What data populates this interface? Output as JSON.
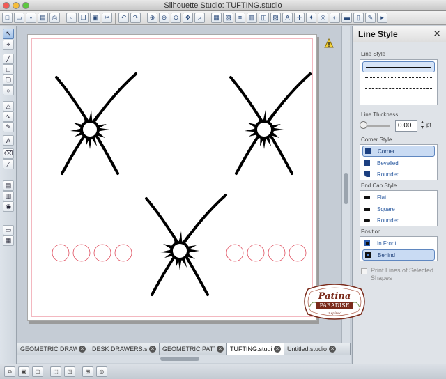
{
  "window": {
    "title": "Silhouette Studio: TUFTING.studio"
  },
  "toolbar": {
    "buttons": [
      "new-icon",
      "open-icon",
      "save-icon",
      "save-as-icon",
      "print-icon",
      "cut-to-icon",
      "copy-icon",
      "paste-icon",
      "scissors-icon",
      "undo-icon",
      "redo-icon",
      "zoom-in-icon",
      "zoom-out-icon",
      "zoom-select-icon",
      "pan-icon",
      "zoom-fit-icon",
      "view-icon",
      "grid-icon",
      "align-icon",
      "replicate-icon",
      "offset-icon",
      "trace-icon",
      "text-icon",
      "transform-icon",
      "point-icon",
      "select-icon",
      "fill-icon",
      "line-icon",
      "cut-icon",
      "star-icon",
      "send-icon"
    ]
  },
  "left_tools": [
    "select-tool-icon",
    "point-edit-icon",
    "line-tool-icon",
    "rectangle-tool-icon",
    "rounded-rect-icon",
    "ellipse-tool-icon",
    "polygon-tool-icon",
    "curve-tool-icon",
    "arc-tool-icon",
    "freehand-tool-icon",
    "text-tool-icon",
    "eraser-tool-icon",
    "knife-tool-icon",
    "library-icon",
    "store-icon",
    "online-icon",
    "design-page-icon",
    "layers-icon"
  ],
  "canvas": {
    "warning_icon": "warning-triangle-icon",
    "colors": {
      "stroke": "#000000",
      "registration": "#e05060"
    }
  },
  "tabs": [
    {
      "label": "GEOMETRIC DRAW...",
      "active": false
    },
    {
      "label": "DESK DRAWERS.st...",
      "active": false
    },
    {
      "label": "GEOMETRIC PATT...",
      "active": false
    },
    {
      "label": "TUFTING.studio",
      "active": true
    },
    {
      "label": "Untitled.studio",
      "active": false
    }
  ],
  "panel": {
    "title": "Line Style",
    "close_icon": "close-icon",
    "line_style_label": "Line Style",
    "line_thickness_label": "Line Thickness",
    "thickness_value": "0.00",
    "thickness_unit": "pt",
    "corner_style_label": "Corner Style",
    "corner_options": [
      {
        "label": "Corner",
        "selected": true
      },
      {
        "label": "Bevelled",
        "selected": false
      },
      {
        "label": "Rounded",
        "selected": false
      }
    ],
    "end_cap_label": "End Cap Style",
    "end_cap_options": [
      {
        "label": "Flat",
        "selected": false
      },
      {
        "label": "Square",
        "selected": false
      },
      {
        "label": "Rounded",
        "selected": false
      }
    ],
    "position_label": "Position",
    "position_options": [
      {
        "label": "In Front",
        "selected": false
      },
      {
        "label": "Behind",
        "selected": true
      }
    ],
    "print_lines_label": "Print Lines of Selected Shapes",
    "print_lines_checked": false
  },
  "watermark": {
    "line1": "Patina",
    "line2": "PARADISE",
    "line3": "inspired"
  },
  "bottom_bar": [
    "duplicate-icon",
    "group-icon",
    "ungroup-icon",
    "weld-icon",
    "compound-icon",
    "release-icon",
    "rotate-icon"
  ],
  "accent": "#5f87c0"
}
